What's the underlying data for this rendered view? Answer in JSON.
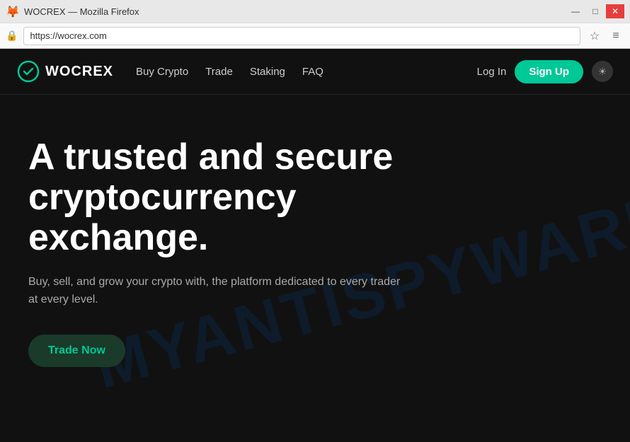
{
  "browser": {
    "title": "WOCREX — Mozilla Firefox",
    "url": "https://wocrex.com",
    "favicon": "🦊",
    "window_controls": {
      "minimize": "—",
      "maximize": "□",
      "close": "✕"
    },
    "toolbar": {
      "bookmark_icon": "☆",
      "menu_icon": "≡",
      "security_icon": "🔒"
    }
  },
  "navbar": {
    "logo_text": "WOCREX",
    "nav_links": [
      {
        "label": "Buy Crypto",
        "id": "buy-crypto"
      },
      {
        "label": "Trade",
        "id": "trade"
      },
      {
        "label": "Staking",
        "id": "staking"
      },
      {
        "label": "FAQ",
        "id": "faq"
      }
    ],
    "login_label": "Log In",
    "signup_label": "Sign Up",
    "theme_icon": "☀"
  },
  "hero": {
    "title": "A trusted and secure cryptocurrency exchange.",
    "subtitle": "Buy, sell, and grow your crypto with, the platform dedicated to every trader at every level.",
    "cta_label": "Trade Now",
    "watermark_line1": "MYANTISPYWARE.COM"
  }
}
